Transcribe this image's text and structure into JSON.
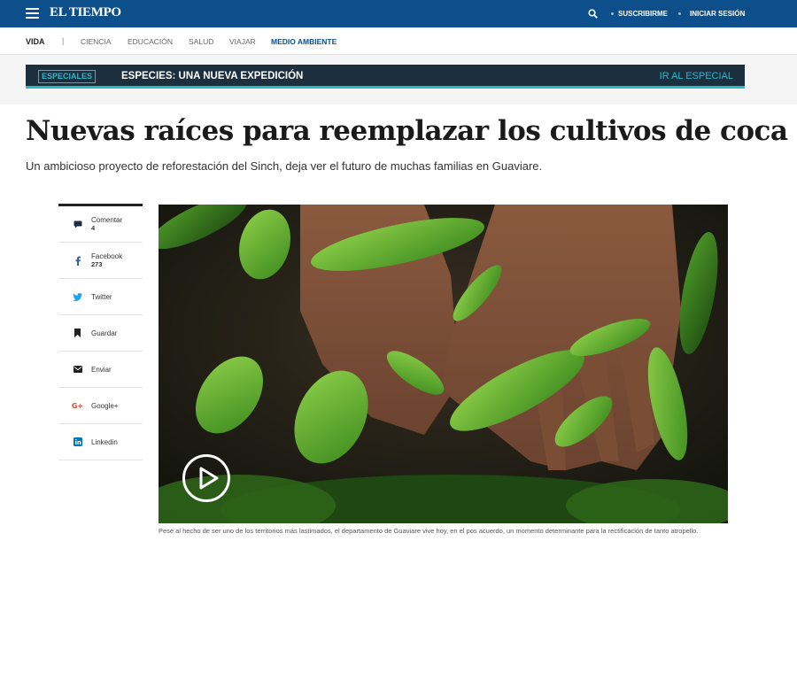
{
  "header": {
    "logo": "EL TIEMPO",
    "subscribe": "SUSCRIBIRME",
    "login": "INICIAR SESIÓN",
    "menu_icon": "hamburger-icon",
    "search_icon": "search-icon",
    "brand_color": "#0d4f8a"
  },
  "sections": {
    "current": "VIDA",
    "items": [
      "CIENCIA",
      "EDUCACIÓN",
      "SALUD",
      "VIAJAR",
      "MEDIO AMBIENTE"
    ],
    "active": "MEDIO AMBIENTE"
  },
  "specials": {
    "badge": "ESPECIALES",
    "title": "ESPECIES: UNA NUEVA EXPEDICIÓN",
    "link": "IR AL ESPECIAL",
    "accent": "#2bb6c9"
  },
  "article": {
    "title": "Nuevas raíces para reemplazar los cultivos de coca",
    "subtitle": "Un ambicioso proyecto de reforestación del Sinch, deja ver el futuro de muchas familias en Guaviare.",
    "caption": "Pese al hecho de ser uno de los territorios más lastimados, el departamento de Guaviare vive hoy, en el pos acuerdo, un momento determinante para la rectificación de tanto atropello.",
    "image_icon": "play-icon"
  },
  "share": [
    {
      "label": "Comentar",
      "count": "4",
      "icon": "comment-icon",
      "color": "#0d4f8a"
    },
    {
      "label": "Facebook",
      "count": "273",
      "icon": "facebook-icon",
      "color": "#3b5998"
    },
    {
      "label": "Twitter",
      "count": "",
      "icon": "twitter-icon",
      "color": "#1da1f2"
    },
    {
      "label": "Guardar",
      "count": "",
      "icon": "bookmark-icon",
      "color": "#222222"
    },
    {
      "label": "Enviar",
      "count": "",
      "icon": "mail-icon",
      "color": "#222222"
    },
    {
      "label": "Google+",
      "count": "",
      "icon": "google-plus-icon",
      "color": "#dd4b39"
    },
    {
      "label": "Linkedin",
      "count": "",
      "icon": "linkedin-icon",
      "color": "#0077b5"
    }
  ]
}
